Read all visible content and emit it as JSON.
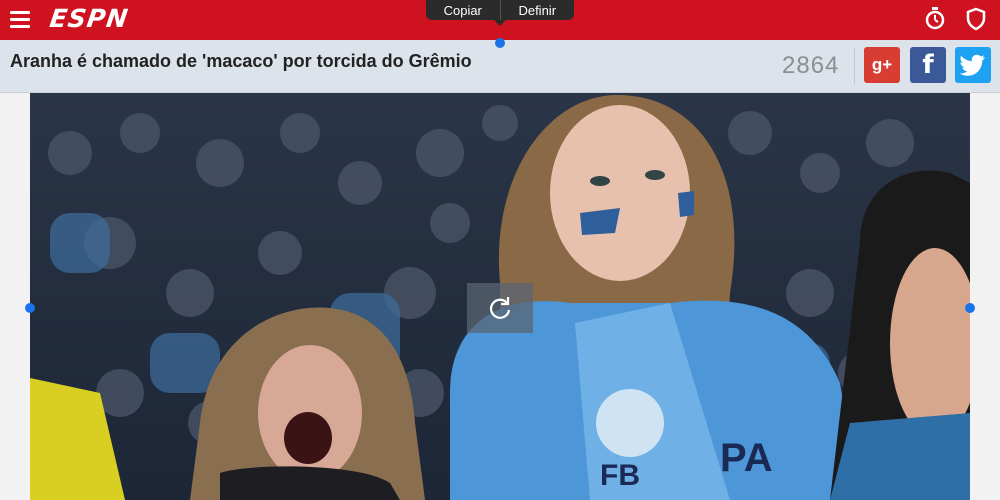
{
  "app": {
    "logo": "ESPN"
  },
  "popup": {
    "copy_label": "Copiar",
    "define_label": "Definir"
  },
  "article": {
    "headline": "Aranha é chamado de 'macaco' por torcida do Grêmio",
    "share_count": "2864"
  },
  "share": {
    "gplus_label": "g+",
    "facebook_label": "f"
  },
  "icons": {
    "menu": "menu-icon",
    "timer": "stopwatch-icon",
    "shield": "shield-icon",
    "twitter": "twitter-bird-icon",
    "reload": "reload-icon"
  },
  "colors": {
    "espn_red": "#cf1220",
    "google_plus": "#d73d32",
    "facebook": "#3b5998",
    "twitter": "#1da1f2"
  }
}
